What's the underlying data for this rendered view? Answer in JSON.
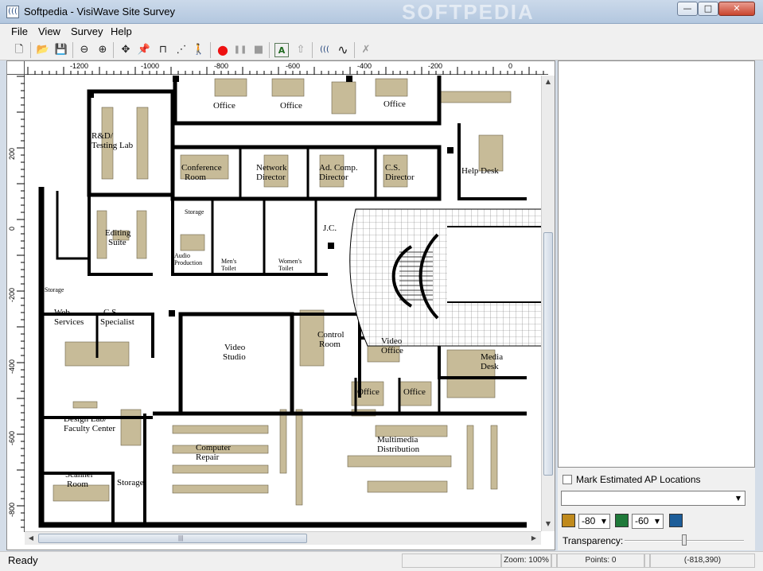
{
  "window": {
    "title": "Softpedia - VisiWave Site Survey",
    "watermark": "SOFTPEDIA",
    "minimize_glyph": "—",
    "maximize_glyph": "□",
    "close_glyph": "✕",
    "app_icon": "((("
  },
  "menu": [
    "File",
    "View",
    "Survey",
    "Help"
  ],
  "toolbar": {
    "icons": [
      "new-file-icon",
      "open-folder-icon",
      "save-icon",
      "zoom-out-icon",
      "zoom-in-icon",
      "pan-icon",
      "pin-icon",
      "measure-icon",
      "calibrate-icon",
      "walk-icon",
      "record-icon",
      "pause-icon",
      "stop-icon",
      "text-icon",
      "upload-icon",
      "signal-icon",
      "waveform-icon",
      "delete-icon"
    ],
    "glyphs": {
      "new": "🗋",
      "open": "📂",
      "save": "💾",
      "zoom_out": "⊖",
      "zoom_in": "⊕",
      "pan": "✥",
      "pin": "📌",
      "measure": "⊓",
      "calibrate": "⋰",
      "walk": "🚶",
      "record": "●",
      "pause": "❚❚",
      "stop": "■",
      "text": "A",
      "upload": "⇧",
      "signal": "(((",
      "wave": "∿",
      "delete": "✗"
    }
  },
  "rulers": {
    "top": [
      "-1200",
      "-1000",
      "-800",
      "-600",
      "-400",
      "-200",
      "0"
    ],
    "left": [
      "200",
      "0",
      "-200",
      "-400",
      "-600",
      "-800"
    ]
  },
  "rooms": {
    "office_1": "Office",
    "office_2": "Office",
    "office_3": "Office",
    "rd_lab_1": "R&D/",
    "rd_lab_2": "Testing Lab",
    "conference_1": "Conference",
    "conference_2": "Room",
    "network_1": "Network",
    "network_2": "Director",
    "adcomp_1": "Ad. Comp.",
    "adcomp_2": "Director",
    "cs_1": "C.S.",
    "cs_2": "Director",
    "help_desk": "Help Desk",
    "storage_1": "Storage",
    "jc": "J.C.",
    "editing_1": "Editing",
    "editing_2": "Suite",
    "audio_1": "Audio",
    "audio_2": "Production",
    "mens_1": "Men's",
    "mens_2": "Toilet",
    "womens_1": "Women's",
    "womens_2": "Toilet",
    "storage_2": "Storage",
    "web_1": "Web",
    "web_2": "Services",
    "csspec_1": "C.S.",
    "csspec_2": "Specialist",
    "video_studio_1": "Video",
    "video_studio_2": "Studio",
    "control_1": "Control",
    "control_2": "Room",
    "video_office_1": "Video",
    "video_office_2": "Office",
    "media_1": "Media",
    "media_2": "Desk",
    "office_4": "Office",
    "office_5": "Office",
    "design_1": "Design Lab/",
    "design_2": "Faculty Center",
    "repair_1": "Computer",
    "repair_2": "Repair",
    "multimedia_1": "Multimedia",
    "multimedia_2": "Distribution",
    "scanner_1": "Scanner",
    "scanner_2": "Room",
    "storage_3": "Storage"
  },
  "panel": {
    "checkbox_label": "Mark Estimated AP Locations",
    "checkbox_checked": false,
    "combo_value": "",
    "level1_value": "-80",
    "level2_value": "-60",
    "swatch_colors": [
      "#c08a1c",
      "#1f7a3a",
      "#1c5d99"
    ],
    "transparency_label": "Transparency:",
    "transparency_level": 0.5,
    "dropdown_glyph": "▼"
  },
  "scroll": {
    "up": "▲",
    "down": "▼",
    "left": "◀",
    "right": "▶",
    "grip": "|||"
  },
  "status": {
    "ready": "Ready",
    "zoom": "Zoom: 100%",
    "points": "Points: 0",
    "coords": "(-818,390)"
  }
}
